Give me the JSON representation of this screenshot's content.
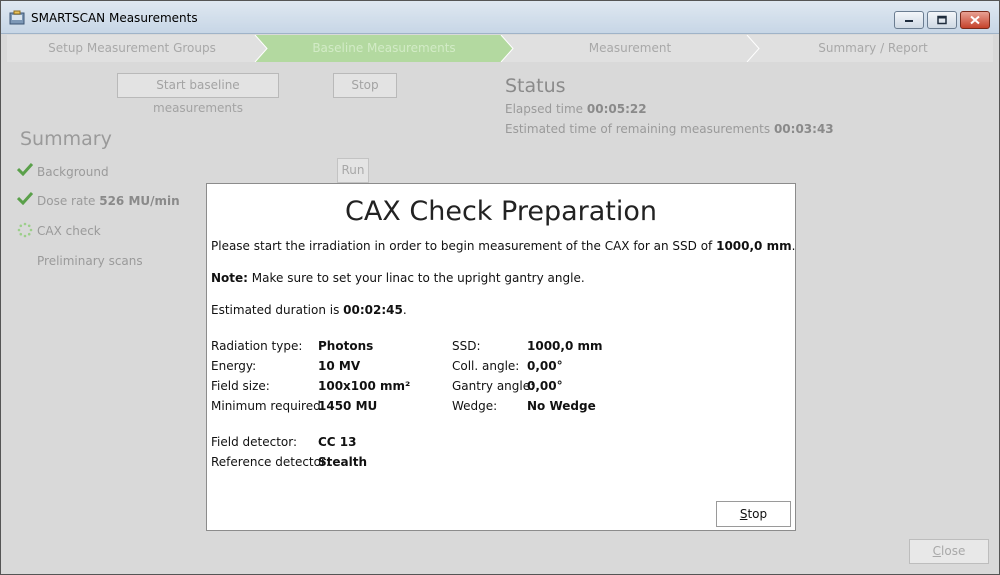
{
  "window": {
    "title": "SMARTSCAN Measurements"
  },
  "steps": [
    {
      "label": "Setup Measurement Groups",
      "active": false
    },
    {
      "label": "Baseline Measurements",
      "active": true
    },
    {
      "label": "Measurement",
      "active": false
    },
    {
      "label": "Summary / Report",
      "active": false
    }
  ],
  "toolbar": {
    "start_baseline_label": "Start baseline measurements",
    "stop_label": "Stop"
  },
  "status": {
    "title": "Status",
    "elapsed_label": "Elapsed time",
    "elapsed_value": "00:05:22",
    "remaining_label": "Estimated time of remaining measurements",
    "remaining_value": "00:03:43"
  },
  "summary": {
    "title": "Summary",
    "items": [
      {
        "label": "Background",
        "value": "",
        "state": "done"
      },
      {
        "label": "Dose rate",
        "value": "526 MU/min",
        "state": "done"
      },
      {
        "label": "CAX check",
        "value": "",
        "state": "running"
      },
      {
        "label": "Preliminary scans",
        "value": "",
        "state": "pending"
      }
    ],
    "run_label": "Run"
  },
  "dialog": {
    "title": "CAX Check Preparation",
    "intro_prefix": "Please start the irradiation in order to begin measurement of the CAX for an SSD of",
    "intro_value": "1000,0 mm",
    "intro_suffix": ".",
    "note_label": "Note:",
    "note_text": "Make sure to set your linac to the upright gantry angle.",
    "duration_prefix": "Estimated duration is",
    "duration_value": "00:02:45",
    "duration_suffix": ".",
    "params_left": [
      {
        "label": "Radiation type:",
        "value": "Photons"
      },
      {
        "label": "Energy:",
        "value": "10 MV"
      },
      {
        "label": "Field size:",
        "value": "100x100 mm²"
      },
      {
        "label": "Minimum required:",
        "value": "1450 MU"
      }
    ],
    "params_right": [
      {
        "label": "SSD:",
        "value": "1000,0 mm"
      },
      {
        "label": "Coll. angle:",
        "value": "0,00°"
      },
      {
        "label": "Gantry angle:",
        "value": "0,00°"
      },
      {
        "label": "Wedge:",
        "value": "No Wedge"
      }
    ],
    "detectors": [
      {
        "label": "Field detector:",
        "value": "CC 13"
      },
      {
        "label": "Reference detector:",
        "value": "Stealth"
      }
    ],
    "stop_label_mnemonic": "S",
    "stop_label_rest": "top"
  },
  "footer": {
    "close_label_mnemonic": "C",
    "close_label_rest": "lose"
  },
  "colors": {
    "active_step": "#b3d9a0",
    "inactive_step": "#e0e0e0",
    "check_green": "#5aa04a"
  }
}
